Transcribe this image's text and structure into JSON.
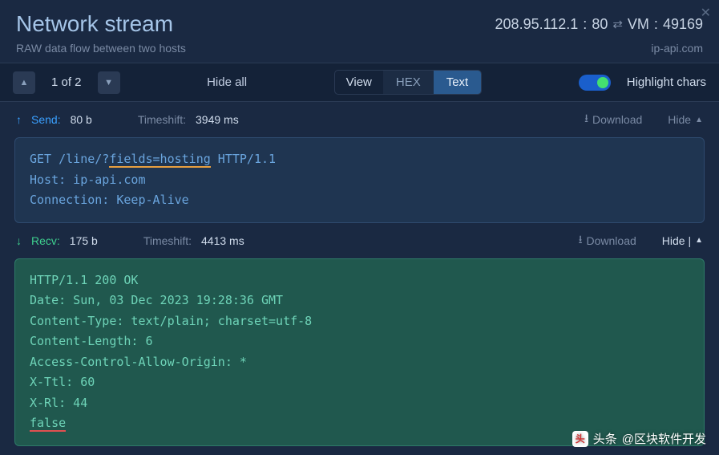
{
  "header": {
    "title": "Network stream",
    "subtitle": "RAW data flow between two hosts",
    "remote_ip": "208.95.112.1",
    "remote_port": "80",
    "local_label": "VM",
    "local_port": "49169",
    "domain": "ip-api.com"
  },
  "toolbar": {
    "page_label": "1 of 2",
    "hide_all": "Hide all",
    "view_label": "View",
    "hex_label": "HEX",
    "text_label": "Text",
    "highlight_label": "Highlight chars"
  },
  "send": {
    "direction_label": "Send:",
    "size": "80 b",
    "timeshift_label": "Timeshift:",
    "timeshift": "3949 ms",
    "download": "Download",
    "hide": "Hide",
    "line1_pre": "GET /line/?",
    "line1_hl": "fields=hosting",
    "line1_post": " HTTP/1.1",
    "line2": "Host: ip-api.com",
    "line3": "Connection: Keep-Alive"
  },
  "recv": {
    "direction_label": "Recv:",
    "size": "175 b",
    "timeshift_label": "Timeshift:",
    "timeshift": "4413 ms",
    "download": "Download",
    "hide": "Hide |",
    "line1": "HTTP/1.1 200 OK",
    "line2": "Date: Sun, 03 Dec 2023 19:28:36 GMT",
    "line3": "Content-Type: text/plain; charset=utf-8",
    "line4": "Content-Length: 6",
    "line5": "Access-Control-Allow-Origin: *",
    "line6": "X-Ttl: 60",
    "line7": "X-Rl: 44",
    "line8": "false"
  },
  "watermark": {
    "prefix": "头条",
    "handle": "@区块软件开发"
  }
}
